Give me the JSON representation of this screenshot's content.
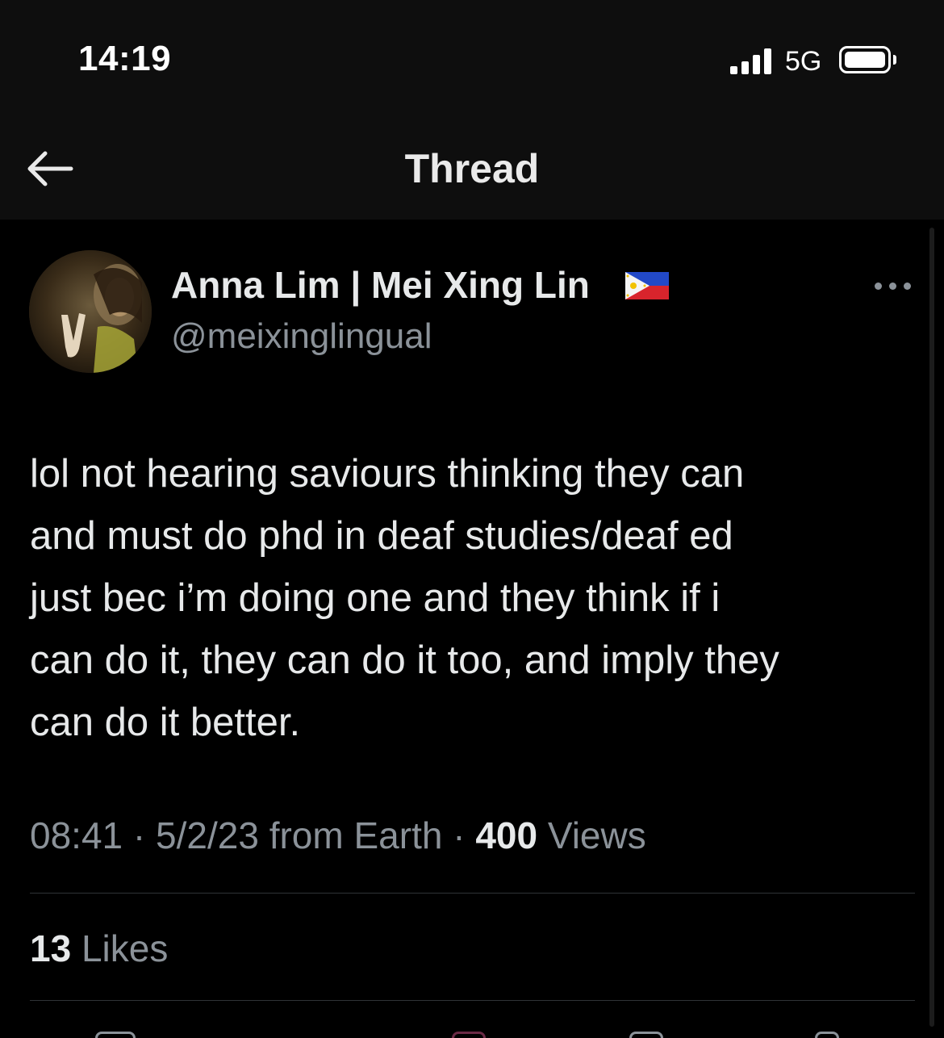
{
  "status_bar": {
    "time": "14:19",
    "network": "5G",
    "signal_bars": 4,
    "battery_level": 1.0
  },
  "header": {
    "title": "Thread",
    "back_icon": "arrow-left-icon"
  },
  "tweet": {
    "display_name": "Anna Lim | Mei Xing Lin",
    "flag_emoji": "philippines-flag-icon",
    "handle": "@meixinglingual",
    "more_icon": "more-horizontal-icon",
    "text": "lol not hearing saviours thinking they can\nand must do phd in deaf studies/deaf ed\njust bec i’m doing one and they think if i\ncan do it, they can do it too, and imply they\ncan do it better.",
    "time": "08:41",
    "date": "5/2/23",
    "source": "from Earth",
    "sep": "·",
    "views_count": "400",
    "views_label": "Views",
    "likes_count": "13",
    "likes_label": "Likes"
  },
  "colors": {
    "background": "#000000",
    "header_bg": "#0e0e0e",
    "text_primary": "#e7e9ea",
    "text_secondary": "#8b9299",
    "divider": "#2f3336"
  }
}
